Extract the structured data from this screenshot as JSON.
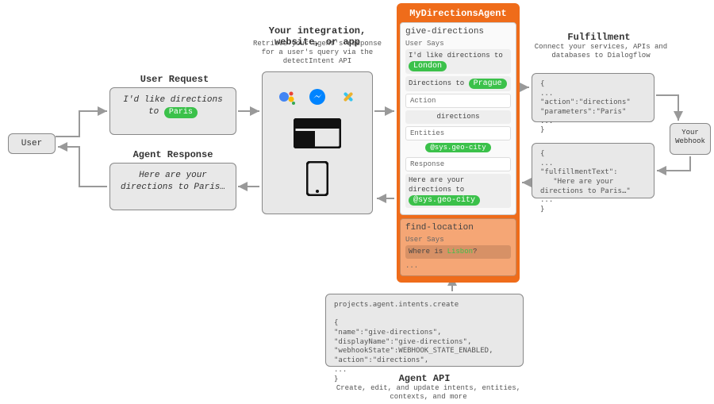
{
  "user": {
    "label": "User"
  },
  "user_request": {
    "title": "User Request",
    "text_prefix": "I'd like directions to ",
    "highlight": "Paris"
  },
  "agent_response": {
    "title": "Agent Response",
    "text": "Here are your directions to Paris…"
  },
  "integration": {
    "title": "Your integration, website, or app",
    "subtitle": "Retrieve your agent's response for a user's query via the detectIntent API"
  },
  "agent": {
    "name": "MyDirectionsAgent",
    "intent1": {
      "name": "give-directions",
      "user_says_label": "User Says",
      "phrase1_prefix": "I'd like directions to ",
      "phrase1_hl": "London",
      "phrase2_prefix": "Directions to ",
      "phrase2_hl": "Prague",
      "action_label": "Action",
      "action_value": "directions",
      "entities_label": "Entities",
      "entity": "@sys.geo-city",
      "response_label": "Response",
      "response_prefix": "Here are your directions to ",
      "response_hl": "@sys.geo-city"
    },
    "intent2": {
      "name": "find-location",
      "user_says_label": "User Says",
      "phrase_prefix": "Where is ",
      "phrase_hl": "Lisbon",
      "phrase_suffix": "?",
      "ellipsis": "..."
    }
  },
  "fulfillment": {
    "title": "Fulfillment",
    "subtitle": "Connect your services, APIs and databases to Dialogflow",
    "request_json": "{\n...\n\"action\":\"directions\"\n\"parameters\":\"Paris\"\n...\n}",
    "response_json": "{\n...\n\"fulfillmentText\":\n   \"Here are your\ndirections to Paris…\"\n...\n}",
    "webhook": "Your Webhook"
  },
  "agent_api": {
    "body": "projects.agent.intents.create\n\n{\n\"name\":\"give-directions\",\n\"displayName\":\"give-directions\",\n\"webhookState\":WEBHOOK_STATE_ENABLED,\n\"action\":\"directions\",\n...\n}",
    "title": "Agent API",
    "subtitle": "Create, edit, and update intents, entities, contexts, and more"
  }
}
